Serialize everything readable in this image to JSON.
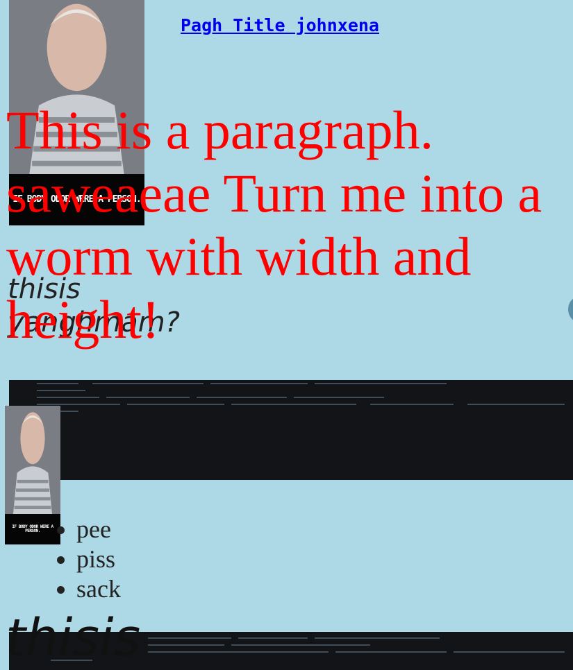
{
  "header": {
    "title_link": "Pagh Title johnxena"
  },
  "meme": {
    "caption": "IF BODY ODOR WERE A PERSON."
  },
  "paragraph": {
    "text": "This is a paragraph. saweaeae Turn me into a worm with width and height!"
  },
  "italic_caption": {
    "text": "thisis yanghmam?"
  },
  "list": {
    "items": [
      "pee",
      "piss",
      "sack"
    ]
  },
  "footer_italic": {
    "text": "thisis"
  },
  "colors": {
    "background": "#add8e6",
    "paragraph": "#ff0000",
    "link": "#0000ee"
  }
}
